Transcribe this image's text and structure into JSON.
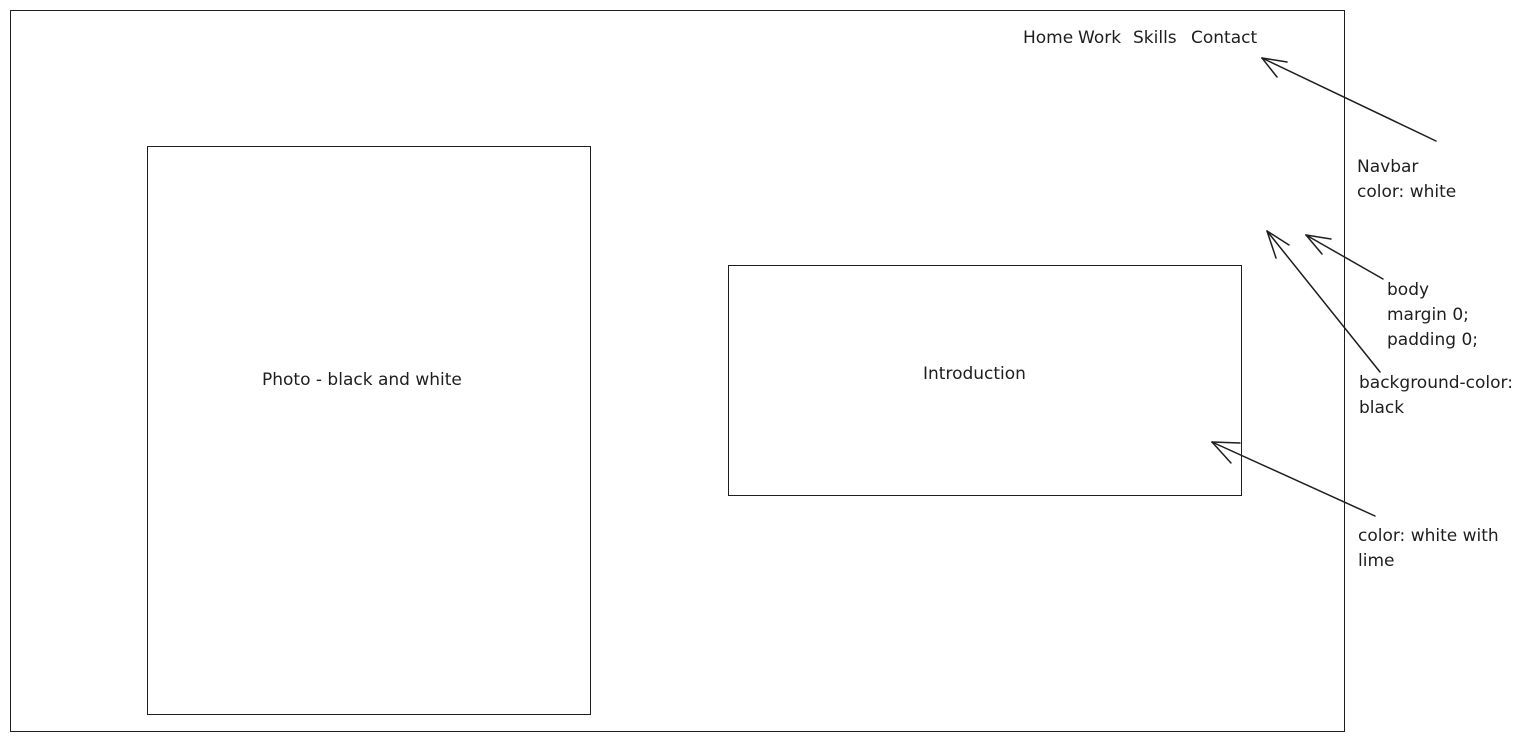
{
  "navbar": {
    "links": [
      "Home",
      "Work",
      "Skills",
      "Contact"
    ]
  },
  "photo": {
    "label": "Photo - black and white"
  },
  "introduction": {
    "label": "Introduction"
  },
  "annotations": {
    "navbar": [
      "Navbar",
      "color: white"
    ],
    "body": [
      "body",
      "margin 0;",
      "padding 0;"
    ],
    "background": [
      "background-color:",
      "black"
    ],
    "intro_color": [
      "color: white with",
      "lime"
    ]
  },
  "colors": {
    "stroke": "#1e1e1e",
    "background": "#ffffff"
  }
}
